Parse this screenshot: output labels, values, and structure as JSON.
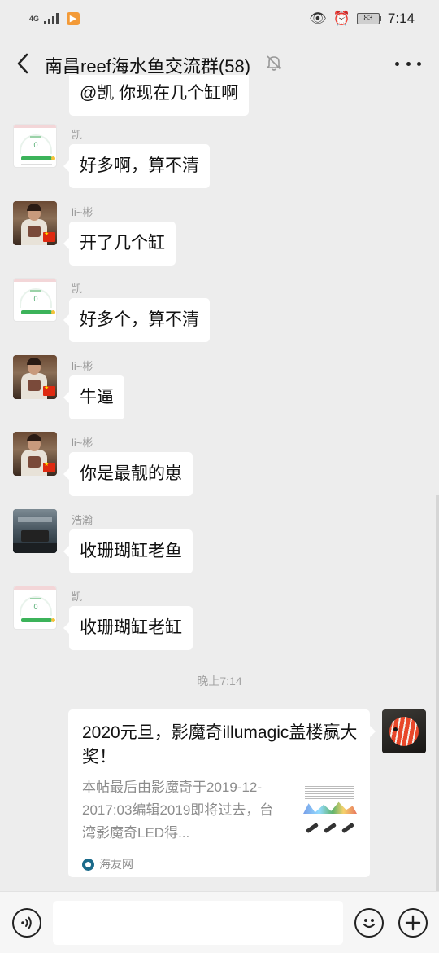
{
  "status_bar": {
    "network": "4G",
    "battery": "83",
    "time": "7:14"
  },
  "header": {
    "title": "南昌reef海水鱼交流群(58)"
  },
  "messages": [
    {
      "sender": "",
      "text": "@凯  你现在几个缸啊",
      "avatar": "app-icon"
    },
    {
      "sender": "凯",
      "text": "好多啊，算不清",
      "avatar": "app-icon"
    },
    {
      "sender": "li~彬",
      "text": "开了几个缸",
      "avatar": "person-photo"
    },
    {
      "sender": "凯",
      "text": "好多个，算不清",
      "avatar": "app-icon"
    },
    {
      "sender": "li~彬",
      "text": "牛逼",
      "avatar": "person-photo"
    },
    {
      "sender": "li~彬",
      "text": "你是最靓的崽",
      "avatar": "person-photo"
    },
    {
      "sender": "浩瀚",
      "text": "收珊瑚缸老鱼",
      "avatar": "tank-photo"
    },
    {
      "sender": "凯",
      "text": "收珊瑚缸老缸",
      "avatar": "app-icon"
    }
  ],
  "time_divider": "晚上7:14",
  "link_card": {
    "title": "2020元旦，影魔奇illumagic盖楼赢大奖！",
    "description": "本帖最后由影魔奇于2019-12-2017:03编辑2019即将过去，台湾影魔奇LED得...",
    "source": "海友网",
    "avatar": "fish-photo"
  },
  "input": {
    "value": "",
    "placeholder": ""
  },
  "icons": {
    "back": "chevron-left-icon",
    "mute": "bell-off-icon",
    "more": "more-dots-icon",
    "voice": "voice-icon",
    "emoji": "emoji-icon",
    "plus": "plus-icon"
  }
}
